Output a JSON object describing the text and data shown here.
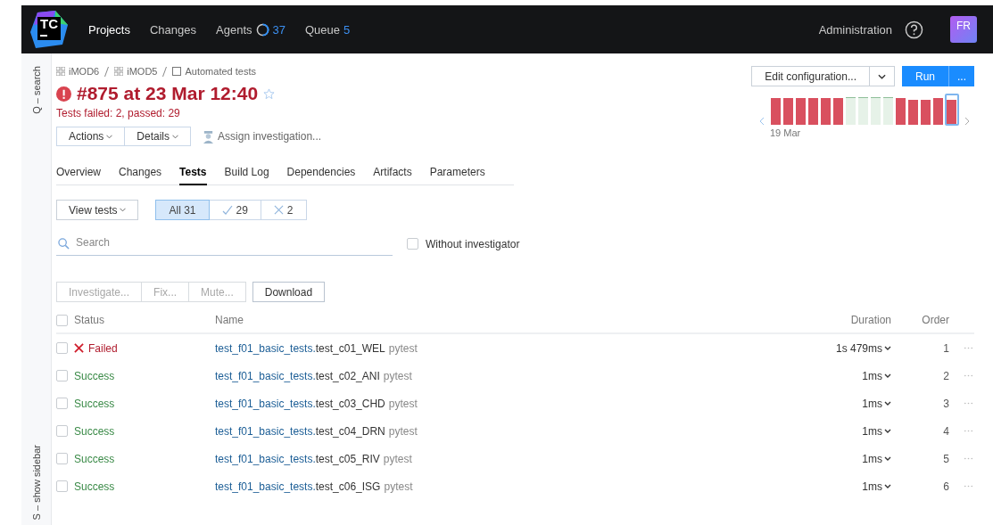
{
  "navbar": {
    "logo": "TC",
    "items": [
      {
        "label": "Projects",
        "selected": true
      },
      {
        "label": "Changes",
        "selected": false
      },
      {
        "label": "Agents",
        "selected": false,
        "count": "37",
        "kind": "agents"
      },
      {
        "label": "Queue",
        "selected": false,
        "count": "5",
        "kind": "queue"
      }
    ],
    "administration": "Administration",
    "avatar": "FR"
  },
  "sidebar": {
    "search_hint": "Q – search",
    "show_hint": "S – show sidebar"
  },
  "breadcrumb": [
    {
      "label": "iMOD6",
      "kind": "project"
    },
    {
      "label": "iMOD5",
      "kind": "project"
    },
    {
      "label": "Automated tests",
      "kind": "config"
    }
  ],
  "build": {
    "title": "#875 at 23 Mar 12:40",
    "kind": "failed",
    "starred": false,
    "summary": "Tests failed: 2, passed: 29"
  },
  "build_actions": [
    "Actions",
    "Details"
  ],
  "assign": "Assign investigation...",
  "edit_configuration": "Edit configuration...",
  "run": {
    "label": "Run",
    "more": "..."
  },
  "history": {
    "date_label": "19 Mar",
    "builds": [
      {
        "kind": "failed",
        "selected": false
      },
      {
        "kind": "failed",
        "selected": false
      },
      {
        "kind": "failed",
        "selected": false
      },
      {
        "kind": "failed",
        "selected": false
      },
      {
        "kind": "failed",
        "selected": false
      },
      {
        "kind": "failed",
        "selected": false
      },
      {
        "kind": "success",
        "selected": false
      },
      {
        "kind": "success",
        "selected": false
      },
      {
        "kind": "success",
        "selected": false
      },
      {
        "kind": "success",
        "selected": false
      },
      {
        "kind": "failed",
        "selected": false
      },
      {
        "kind": "failed",
        "selected": false
      },
      {
        "kind": "failed",
        "selected": false
      },
      {
        "kind": "failed",
        "selected": false
      },
      {
        "kind": "failed",
        "selected": true
      }
    ]
  },
  "tabs": [
    {
      "label": "Overview",
      "selected": false
    },
    {
      "label": "Changes",
      "selected": false
    },
    {
      "label": "Tests",
      "selected": true
    },
    {
      "label": "Build Log",
      "selected": false
    },
    {
      "label": "Dependencies",
      "selected": false
    },
    {
      "label": "Artifacts",
      "selected": false
    },
    {
      "label": "Parameters",
      "selected": false
    }
  ],
  "view_tests": "View tests",
  "filters": [
    {
      "label": "All 31",
      "kind": "all",
      "selected": true
    },
    {
      "label": "29",
      "kind": "passed",
      "selected": false
    },
    {
      "label": "2",
      "kind": "failed",
      "selected": false
    }
  ],
  "search": {
    "placeholder": "Search"
  },
  "without_investigator": {
    "label": "Without investigator",
    "checked": false
  },
  "bulk_actions": [
    {
      "label": "Investigate...",
      "disabled": true
    },
    {
      "label": "Fix...",
      "disabled": true
    },
    {
      "label": "Mute...",
      "disabled": true
    },
    {
      "label": "Download",
      "disabled": false
    }
  ],
  "table": {
    "select_all": {
      "checked": false
    },
    "columns": [
      "Status",
      "Name",
      "Duration",
      "Order"
    ],
    "rows": [
      {
        "checked": false,
        "status": "Failed",
        "kind": "failed",
        "suite": "test_f01_basic_tests.",
        "test": "test_c01_WEL",
        "runner": "pytest",
        "duration": "1s 479ms",
        "order": "1"
      },
      {
        "checked": false,
        "status": "Success",
        "kind": "success",
        "suite": "test_f01_basic_tests.",
        "test": "test_c02_ANI",
        "runner": "pytest",
        "duration": "1ms",
        "order": "2"
      },
      {
        "checked": false,
        "status": "Success",
        "kind": "success",
        "suite": "test_f01_basic_tests.",
        "test": "test_c03_CHD",
        "runner": "pytest",
        "duration": "1ms",
        "order": "3"
      },
      {
        "checked": false,
        "status": "Success",
        "kind": "success",
        "suite": "test_f01_basic_tests.",
        "test": "test_c04_DRN",
        "runner": "pytest",
        "duration": "1ms",
        "order": "4"
      },
      {
        "checked": false,
        "status": "Success",
        "kind": "success",
        "suite": "test_f01_basic_tests.",
        "test": "test_c05_RIV",
        "runner": "pytest",
        "duration": "1ms",
        "order": "5"
      },
      {
        "checked": false,
        "status": "Success",
        "kind": "success",
        "suite": "test_f01_basic_tests.",
        "test": "test_c06_ISG",
        "runner": "pytest",
        "duration": "1ms",
        "order": "6"
      }
    ]
  }
}
